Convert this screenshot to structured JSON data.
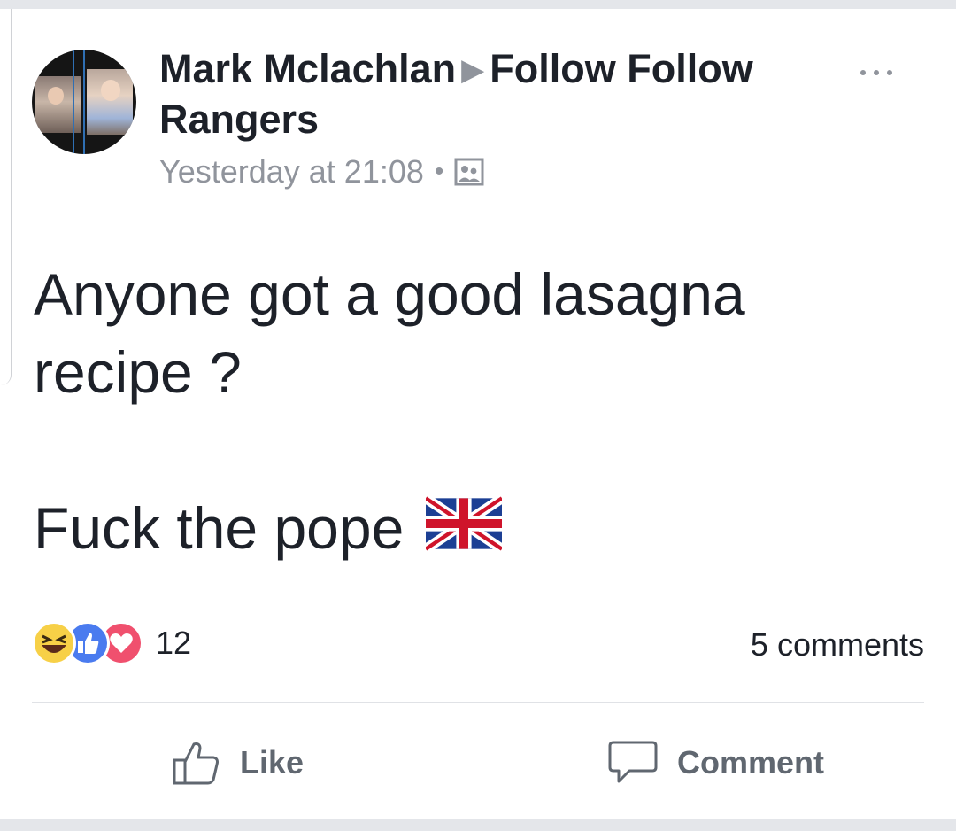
{
  "post": {
    "author": "Mark Mclachlan",
    "target_page": "Follow Follow Rangers",
    "timestamp": "Yesterday at 21:08",
    "separator_dot": "•",
    "privacy_icon": "album-icon",
    "text_line_1": "Anyone got a good lasagna recipe ?",
    "text_line_2": "Fuck the pope",
    "emoji": "union-jack-flag-icon"
  },
  "reactions": {
    "types": [
      "haha",
      "like",
      "love"
    ],
    "count": "12",
    "comments": "5 comments",
    "colors": {
      "haha": "#f7d047",
      "like": "#4a7bef",
      "love": "#f0506e"
    }
  },
  "actions": {
    "like_label": "Like",
    "comment_label": "Comment"
  },
  "colors": {
    "text": "#1d2129",
    "meta": "#90949c",
    "action": "#606770",
    "band": "#e4e6ea"
  }
}
